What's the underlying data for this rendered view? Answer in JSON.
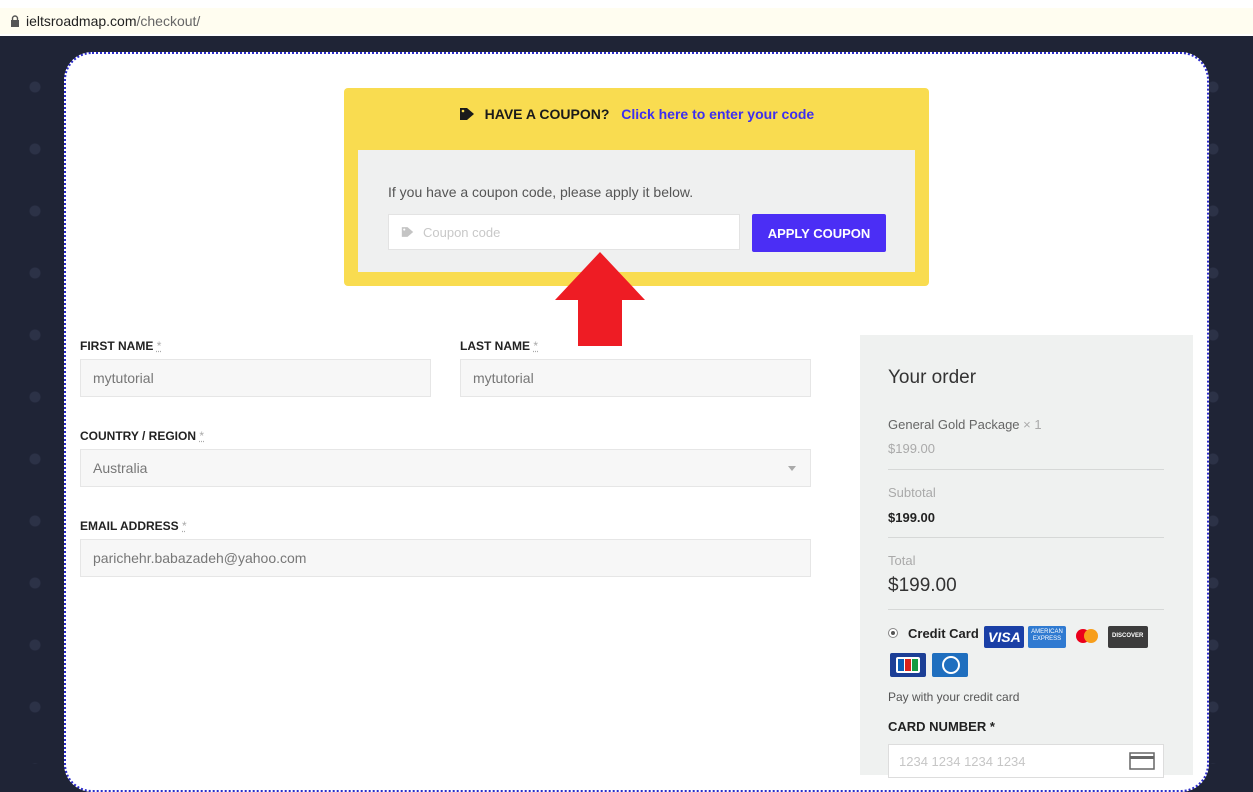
{
  "browser": {
    "url_domain": "ieltsroadmap.com",
    "url_path": "/checkout/"
  },
  "coupon": {
    "heading": "HAVE A COUPON?",
    "link": "Click here to enter your code",
    "description": "If you have a coupon code, please apply it below.",
    "input_placeholder": "Coupon code",
    "apply_label": "APPLY COUPON",
    "icon": "tag-icon"
  },
  "form": {
    "first_name": {
      "label": "FIRST NAME",
      "value": "mytutorial"
    },
    "last_name": {
      "label": "LAST NAME",
      "value": "mytutorial"
    },
    "country": {
      "label": "COUNTRY / REGION",
      "value": "Australia"
    },
    "email": {
      "label": "EMAIL ADDRESS",
      "value": "parichehr.babazadeh@yahoo.com"
    },
    "required_mark": "*"
  },
  "order": {
    "title": "Your order",
    "product_name": "General Gold Package",
    "product_qty": "× 1",
    "product_price": "$199.00",
    "subtotal_label": "Subtotal",
    "subtotal_value": "$199.00",
    "total_label": "Total",
    "total_value": "$199.00"
  },
  "payment": {
    "method_label": "Credit Card",
    "description": "Pay with your credit card",
    "card_number_label": "CARD NUMBER *",
    "card_number_placeholder": "1234 1234 1234 1234",
    "logos": [
      "VISA",
      "AMERICAN EXPRESS",
      "mastercard",
      "DISCOVER",
      "JCB",
      "Diners Club"
    ],
    "logo_text": {
      "visa": "VISA",
      "amex_1": "AMERICAN",
      "amex_2": "EXPRESS",
      "discover": "DISCOVER"
    }
  },
  "colors": {
    "accent": "#4b2ef5",
    "coupon_bg": "#f9dc50",
    "arrow": "#ee1c24",
    "page_bg": "#1f2436"
  }
}
